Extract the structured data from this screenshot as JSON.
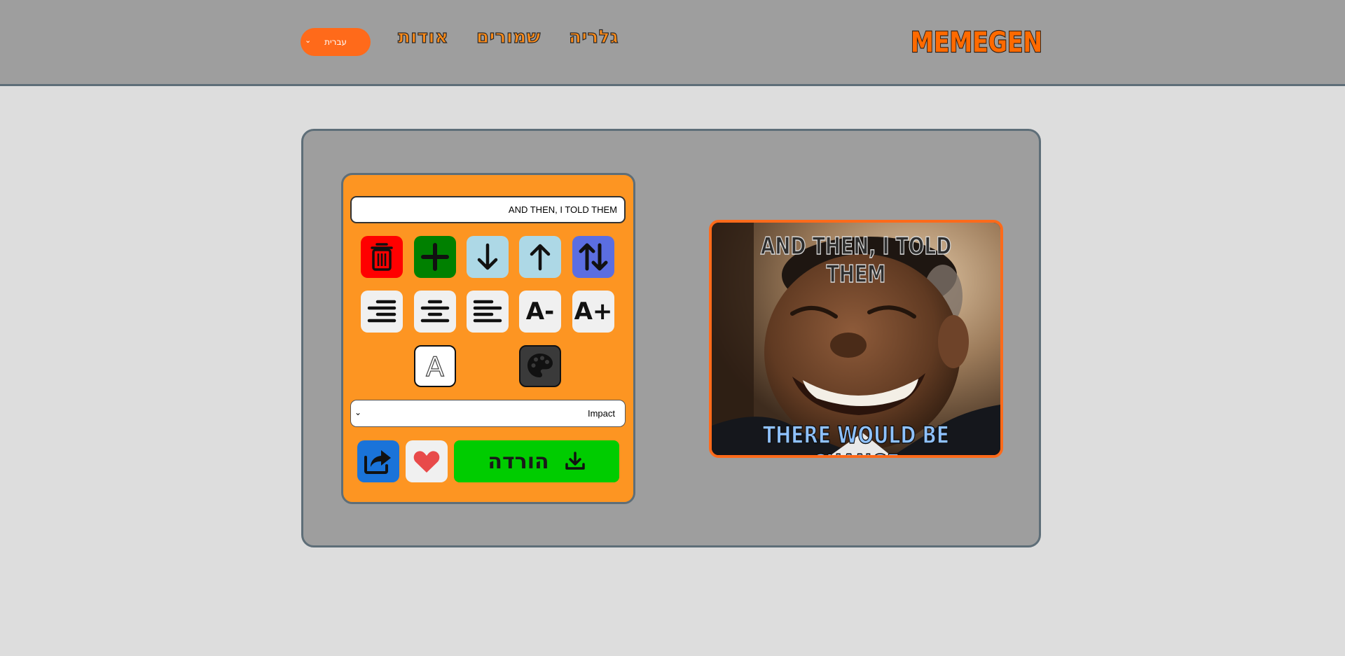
{
  "header": {
    "logo_text": "MEMEGEN",
    "nav": {
      "gallery": "גלריה",
      "saved": "שמורים",
      "about": "אודות"
    },
    "language": "עברית"
  },
  "editor": {
    "text_value": "AND THEN, I TOLD THEM",
    "font_value": "Impact",
    "download_label": "הורדה",
    "buttons": {
      "row1": [
        "trash-icon",
        "plus-icon",
        "arrow-down-icon",
        "arrow-up-icon",
        "swap-vertical-icon"
      ],
      "row2": [
        "align-right-icon",
        "align-center-icon",
        "align-left-icon"
      ],
      "font_size_decrease": "A-",
      "font_size_increase": "A+",
      "stroke_color_label": "A"
    }
  },
  "preview": {
    "top_text": "AND THEN, I TOLD THEM",
    "bottom_text": "THERE WOULD BE CHANGE"
  },
  "colors": {
    "header_bg": "#9e9e9e",
    "page_bg": "#dddddd",
    "accent_orange": "#fd9522",
    "delete_red": "#ff0000",
    "add_green": "#008000",
    "move_lightblue": "#add8e6",
    "switch_blue": "#5b6ee1",
    "download_green": "#00cc00",
    "share_blue": "#1a73d9",
    "heart_red": "#e84a4a"
  }
}
